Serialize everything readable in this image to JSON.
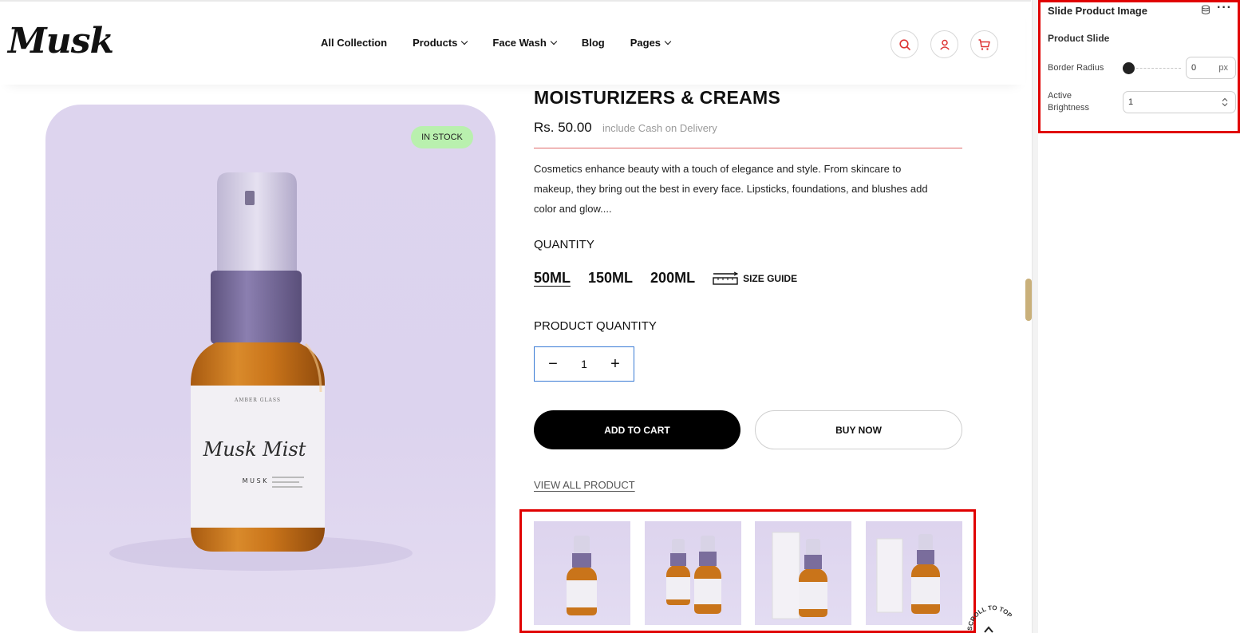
{
  "header": {
    "logo": "Musk",
    "nav": [
      {
        "label": "All Collection"
      },
      {
        "label": "Products"
      },
      {
        "label": "Face Wash"
      },
      {
        "label": "Blog"
      },
      {
        "label": "Pages"
      }
    ]
  },
  "product": {
    "badge": "IN STOCK",
    "image_label_name": "Musk Mist",
    "image_label_brand": "AMBER GLASS",
    "image_label_letters": "M U S K",
    "title": "MOISTURIZERS & CREAMS",
    "price": "Rs. 50.00",
    "price_note": "include Cash on Delivery",
    "description": "Cosmetics enhance beauty with a touch of elegance and style. From skincare to makeup, they bring out the best in every face. Lipsticks, foundations, and blushes add color and glow....",
    "quantity_label": "QUANTITY",
    "sizes": [
      "50ML",
      "150ML",
      "200ML"
    ],
    "size_guide": "SIZE GUIDE",
    "product_quantity_label": "PRODUCT QUANTITY",
    "quantity_value": "1",
    "minus": "−",
    "plus": "+",
    "add_to_cart": "ADD TO CART",
    "buy_now": "BUY NOW",
    "view_all": "VIEW ALL PRODUCT",
    "scroll_to_top": "SCROLL TO TOP"
  },
  "panel": {
    "title": "Slide Product Image",
    "more": "···",
    "subtitle": "Product Slide",
    "border_radius_label": "Border Radius",
    "border_radius_value": "0",
    "border_radius_unit": "px",
    "border_radius_slider_value": 0,
    "active_brightness_label": "Active Brightness",
    "active_brightness_value": "1"
  },
  "colors": {
    "accent_red": "#e00000",
    "badge_green": "#b9f0ae",
    "product_bg": "#ddd4ee",
    "amber": "#c9741a",
    "pump_purple": "#7a6d9c"
  }
}
